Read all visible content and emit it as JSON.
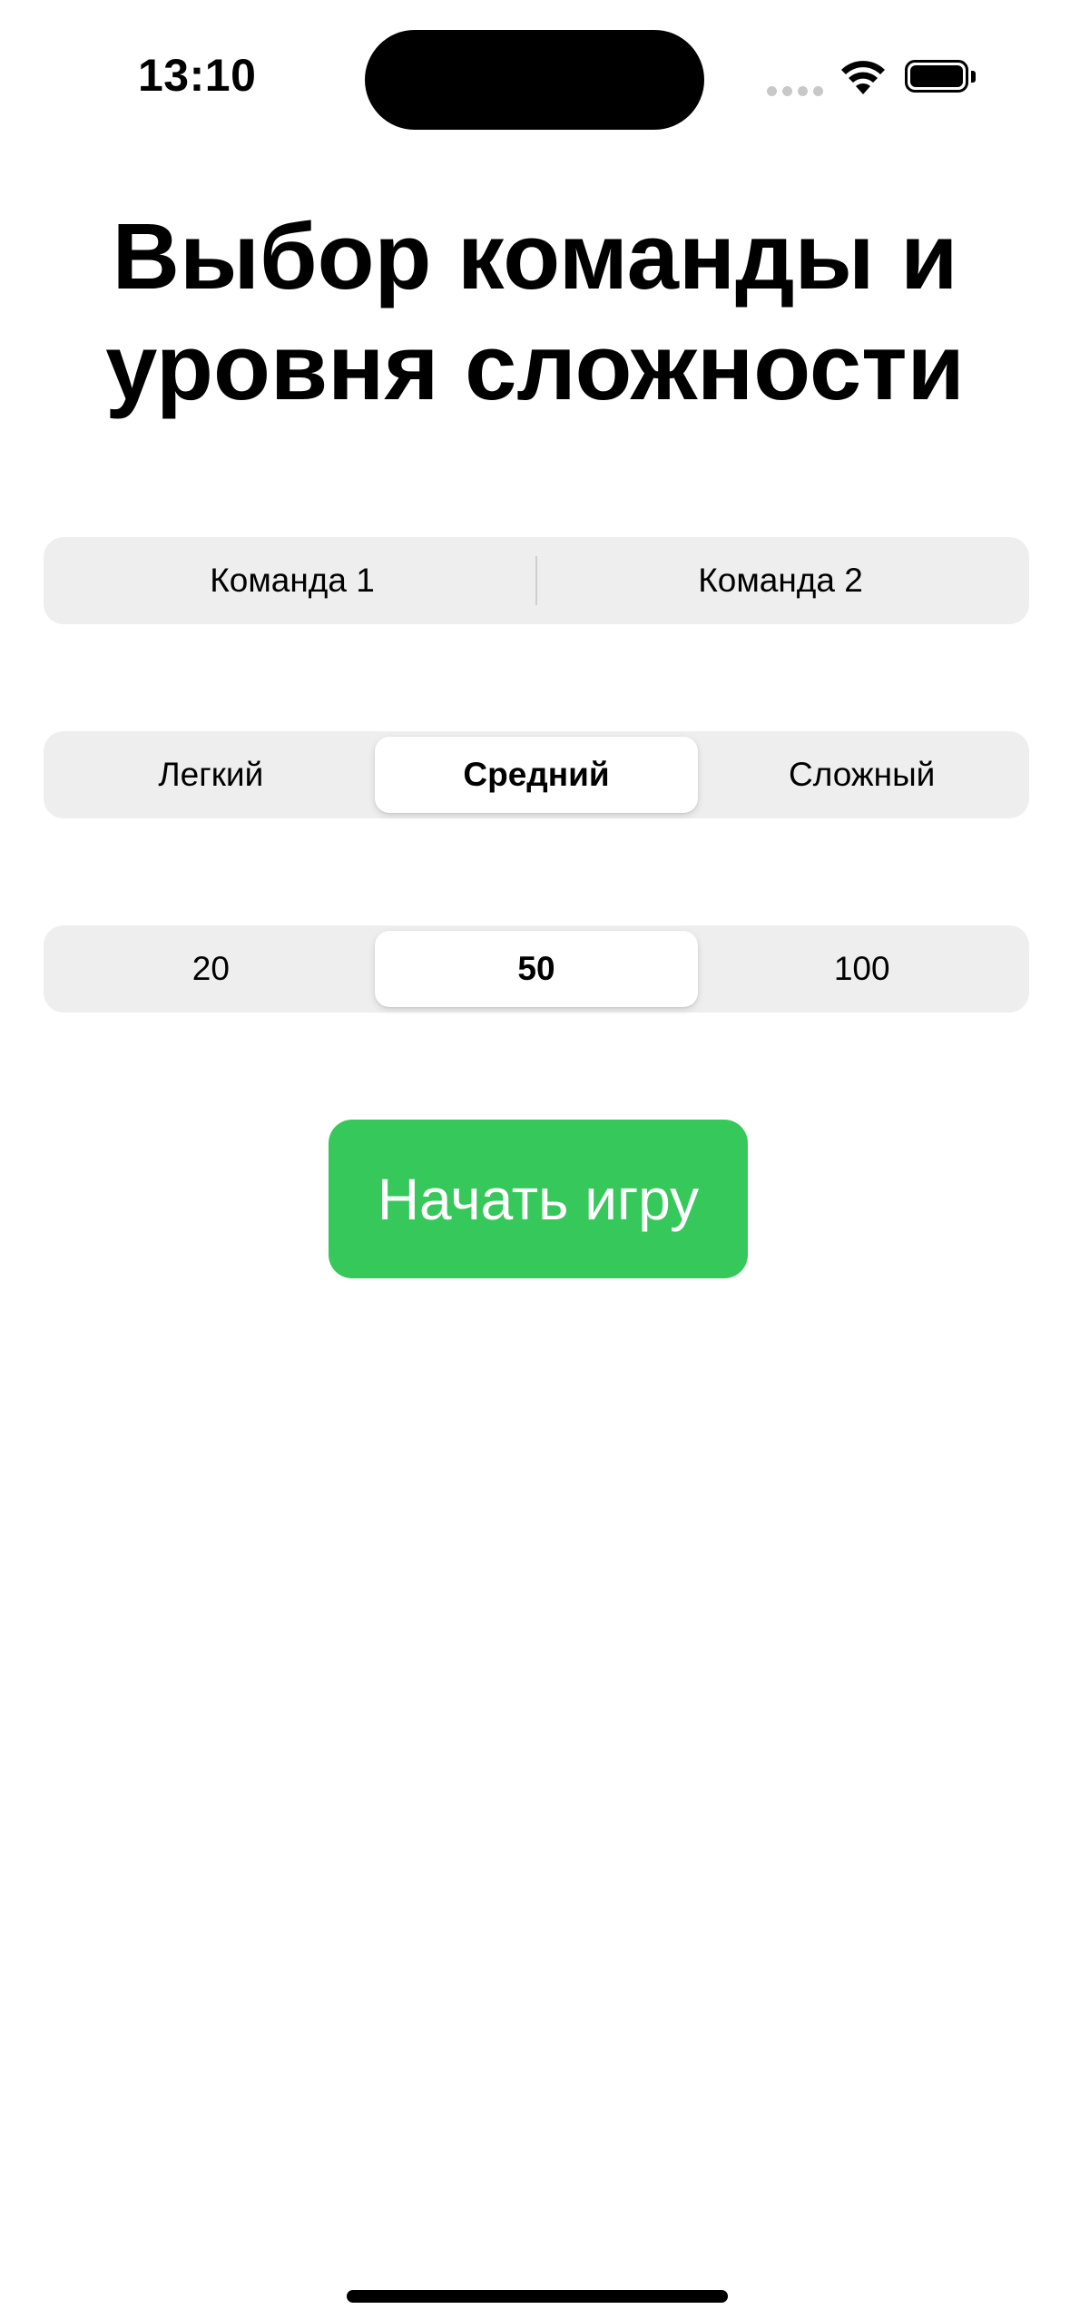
{
  "status_bar": {
    "time": "13:10",
    "icons": [
      "cellular-signal-icon",
      "wifi-icon",
      "battery-icon"
    ]
  },
  "title": {
    "line1": "Выбор команды и",
    "line2": "уровня сложности"
  },
  "team_selector": {
    "options": [
      "Команда 1",
      "Команда 2"
    ],
    "selected": null
  },
  "difficulty_selector": {
    "options": [
      "Легкий",
      "Средний",
      "Сложный"
    ],
    "selected": "Средний"
  },
  "count_selector": {
    "options": [
      "20",
      "50",
      "100"
    ],
    "selected": "50"
  },
  "start_button": {
    "label": "Начать игру"
  },
  "colors": {
    "accent_green": "#37c85c",
    "segment_background": "#eeeeef",
    "text": "#000000",
    "background": "#ffffff"
  }
}
